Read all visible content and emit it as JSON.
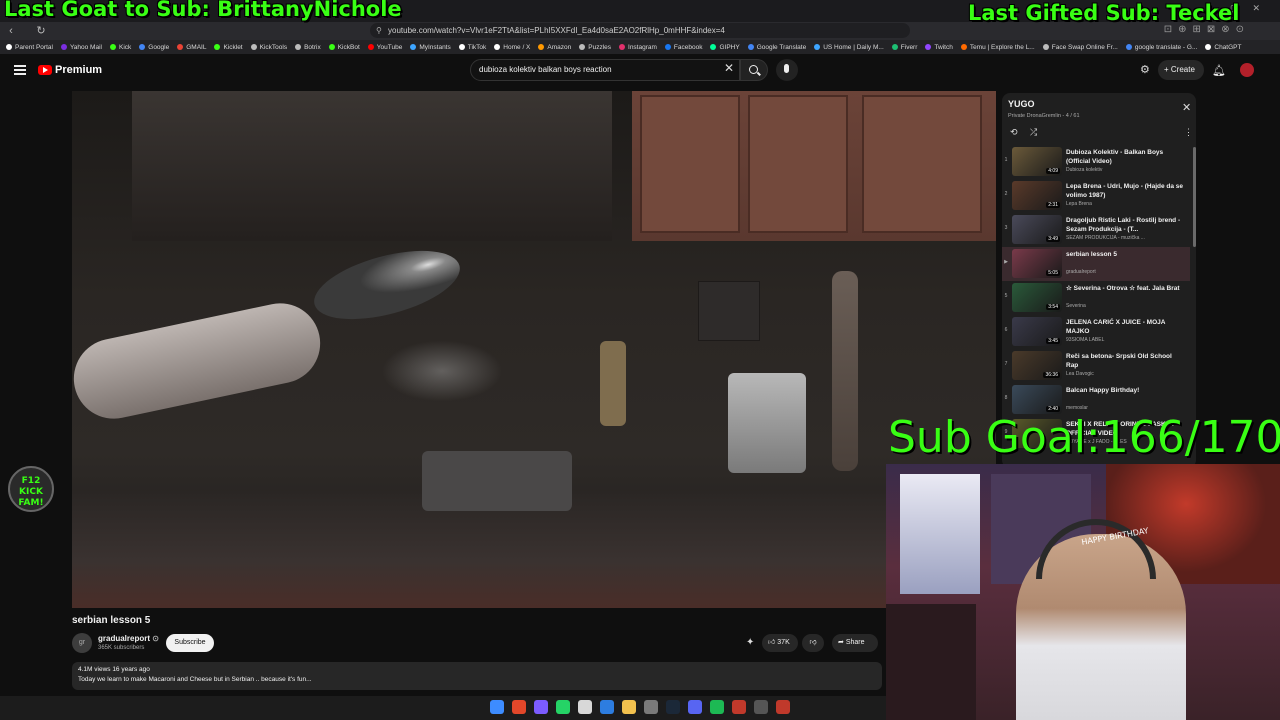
{
  "overlays": {
    "last_goat": "Last Goat to Sub: BrittanyNichole",
    "last_gifted": "Last Gifted Sub: Teckel",
    "sub_goal": "Sub Goal:166/170",
    "kick_badge": "F12 KICK FAM!"
  },
  "browser": {
    "url": "youtube.com/watch?v=Vlvr1eF2TtA&list=PLhI5XXFdI_Ea4d0saE2AO2fRlHp_0mHHF&index=4",
    "bookmarks": [
      {
        "label": "Parent Portal",
        "color": "#ffffff"
      },
      {
        "label": "Yahoo Mail",
        "color": "#7b2ee0"
      },
      {
        "label": "Kick",
        "color": "#39ff14"
      },
      {
        "label": "Google",
        "color": "#4285f4"
      },
      {
        "label": "GMAIL",
        "color": "#ea4335"
      },
      {
        "label": "Kicklet",
        "color": "#39ff14"
      },
      {
        "label": "KickTools",
        "color": "#bbbbbb"
      },
      {
        "label": "Botrix",
        "color": "#bbbbbb"
      },
      {
        "label": "KickBot",
        "color": "#39ff14"
      },
      {
        "label": "YouTube",
        "color": "#ff0000"
      },
      {
        "label": "MyInstants",
        "color": "#3da5ff"
      },
      {
        "label": "TikTok",
        "color": "#ffffff"
      },
      {
        "label": "Home / X",
        "color": "#ffffff"
      },
      {
        "label": "Amazon",
        "color": "#ff9900"
      },
      {
        "label": "Puzzles",
        "color": "#bbbbbb"
      },
      {
        "label": "Instagram",
        "color": "#e1306c"
      },
      {
        "label": "Facebook",
        "color": "#1877f2"
      },
      {
        "label": "GIPHY",
        "color": "#00ff99"
      },
      {
        "label": "Google Translate",
        "color": "#4285f4"
      },
      {
        "label": "US Home | Daily M...",
        "color": "#3da5ff"
      },
      {
        "label": "Fiverr",
        "color": "#1dbf73"
      },
      {
        "label": "Twitch",
        "color": "#9146ff"
      },
      {
        "label": "Temu | Explore the L...",
        "color": "#ff6a00"
      },
      {
        "label": "Face Swap Online Fr...",
        "color": "#bbbbbb"
      },
      {
        "label": "google translate - G...",
        "color": "#4285f4"
      },
      {
        "label": "ChatGPT",
        "color": "#ffffff"
      }
    ]
  },
  "youtube": {
    "logo": "Premium",
    "search_value": "dubioza kolektiv balkan boys reaction",
    "create_label": "Create",
    "video": {
      "title": "serbian lesson 5",
      "channel": "gradualreport",
      "channel_avatar": "gr",
      "subscribers": "365K subscribers",
      "subscribe_label": "Subscribe",
      "likes": "37K",
      "share_label": "Share",
      "meta": "4.1M views  16 years ago",
      "description": "Today we learn to make Macaroni and Cheese but in Serbian .. because it's fun..."
    },
    "playlist": {
      "title": "YUGO",
      "subtitle": "Private  DronaGremlin  -  4 / 61",
      "items": [
        {
          "index": "1",
          "title": "Dubioza Kolektiv - Balkan Boys (Official Video)",
          "channel": "Dubioza kolektiv",
          "duration": "4:09"
        },
        {
          "index": "2",
          "title": "Lepa Brena - Udri, Mujo - (Hajde da se volimo 1987)",
          "channel": "Lepa Brena",
          "duration": "2:31"
        },
        {
          "index": "3",
          "title": "Dragoljub Ristic Laki - Rostilj brend - Sezam Produkcija - (T...",
          "channel": "SEZAM PRODUKCIJA - muzička ...",
          "duration": "3:49"
        },
        {
          "index": "▶",
          "title": "serbian lesson 5",
          "channel": "gradualreport",
          "duration": "5:05"
        },
        {
          "index": "5",
          "title": "☆ Severina - Otrova ☆ feat. Jala Brat",
          "channel": "Severina",
          "duration": "3:54"
        },
        {
          "index": "6",
          "title": "JELENA CARIĆ X JUICE - MOJA MAJKO",
          "channel": "93SIOMA LABEL",
          "duration": "3:45"
        },
        {
          "index": "7",
          "title": "Reči sa betona- Srpski Old School Rap",
          "channel": "Lea Davogic",
          "duration": "36:36"
        },
        {
          "index": "8",
          "title": "Balcan Happy Birthday!",
          "channel": "memoslar",
          "duration": "2:40"
        },
        {
          "index": "9",
          "title": "SEKSI X RELJA - ORINNO PASKI X OFFICIAL VIDEO",
          "channel": "VOYAGE x J FADO - PLES",
          "duration": ""
        }
      ]
    }
  },
  "webcam": {
    "hat_text": "HAPPY BIRTHDAY"
  }
}
